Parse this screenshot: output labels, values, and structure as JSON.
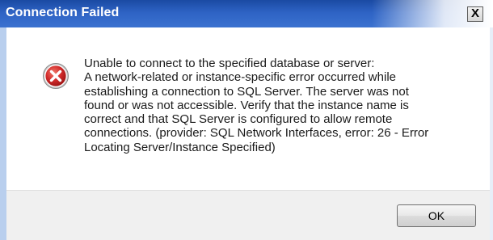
{
  "window": {
    "title": "Connection Failed",
    "close_label": "X"
  },
  "icon": "error-icon",
  "message": {
    "text": "Unable to connect to the specified database or server:\nA network-related or instance-specific error occurred while\nestablishing a connection to SQL Server. The server was not\nfound or was not accessible. Verify that the instance name is\ncorrect and that SQL Server is configured to allow remote\nconnections. (provider: SQL Network Interfaces, error: 26 - Error\nLocating Server/Instance Specified)"
  },
  "buttons": {
    "ok_label": "OK"
  },
  "colors": {
    "titlebar": "#2e63c4",
    "error_icon": "#d22b2b",
    "footer": "#f0f0f0"
  }
}
